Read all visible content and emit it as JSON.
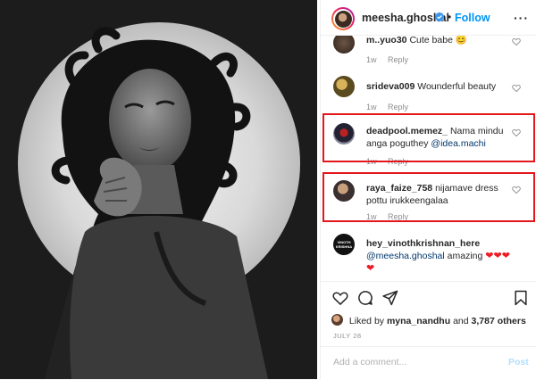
{
  "header": {
    "username": "meesha.ghoshal",
    "separator": "•",
    "follow_label": "Follow",
    "more_label": "···"
  },
  "comments": [
    {
      "username": "m..yuo30",
      "text": "Cute babe",
      "time": "1w",
      "reply_label": "Reply"
    },
    {
      "username": "srideva009",
      "text": "Wounderful beauty",
      "time": "1w",
      "reply_label": "Reply"
    },
    {
      "username": "deadpool.memez_",
      "text": "Nama mindu anga poguthey",
      "mention": "@idea.machi",
      "time": "1w",
      "reply_label": "Reply",
      "highlighted": true
    },
    {
      "username": "raya_faize_758",
      "text": "nijamave dress pottu irukkeengalaa",
      "time": "1w",
      "reply_label": "Reply",
      "highlighted": true
    },
    {
      "username": "hey_vinothkrishnan_here",
      "mention": "@meesha.ghoshal",
      "text": "amazing",
      "hearts": "❤❤❤❤",
      "avatar_text": "VINOTH KRISHNA"
    }
  ],
  "likes": {
    "prefix": "Liked by",
    "user": "myna_nandhu",
    "conjunction": "and",
    "others": "3,787 others"
  },
  "date": "JULY 28",
  "add_comment": {
    "placeholder": "Add a comment...",
    "post_label": "Post"
  },
  "colors": {
    "accent": "#0095f6",
    "highlight_border": "#e3161b",
    "heart_red": "#ed1c24",
    "meta_gray": "#8e8e8e"
  },
  "icons": [
    "verified-badge-icon",
    "heart-icon",
    "comment-icon",
    "share-icon",
    "bookmark-icon",
    "more-icon"
  ]
}
